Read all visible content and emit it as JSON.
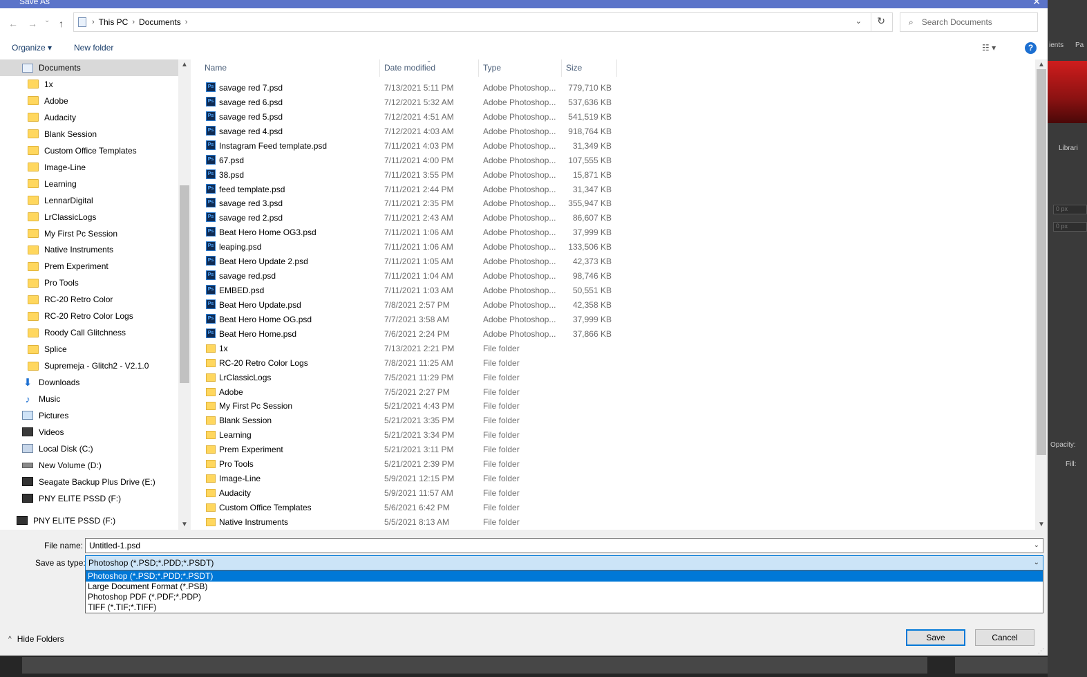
{
  "window": {
    "title": "Save As",
    "close_glyph": "✕"
  },
  "address": {
    "back_glyph": "←",
    "forward_glyph": "→",
    "recent_glyph": "⌄",
    "up_glyph": "↑",
    "crumbs": [
      "This PC",
      "Documents"
    ],
    "separator": "›",
    "dropdown_glyph": "⌄",
    "refresh_glyph": "↻",
    "search_placeholder": "Search Documents",
    "search_icon_glyph": "⌕"
  },
  "toolbar": {
    "organize_label": "Organize ▾",
    "new_folder_label": "New folder",
    "view_glyph": "☷ ▾",
    "help_glyph": "?"
  },
  "nav_items": [
    {
      "label": "Documents",
      "icon": "documents-icon",
      "indent": 1,
      "selected": true
    },
    {
      "label": "1x",
      "icon": "folder-icon",
      "indent": 2
    },
    {
      "label": "Adobe",
      "icon": "folder-icon",
      "indent": 2
    },
    {
      "label": "Audacity",
      "icon": "folder-icon",
      "indent": 2
    },
    {
      "label": "Blank Session",
      "icon": "folder-icon",
      "indent": 2
    },
    {
      "label": "Custom Office Templates",
      "icon": "folder-icon",
      "indent": 2
    },
    {
      "label": "Image-Line",
      "icon": "folder-icon",
      "indent": 2
    },
    {
      "label": "Learning",
      "icon": "folder-icon",
      "indent": 2
    },
    {
      "label": "LennarDigital",
      "icon": "folder-icon",
      "indent": 2
    },
    {
      "label": "LrClassicLogs",
      "icon": "folder-icon",
      "indent": 2
    },
    {
      "label": "My First Pc Session",
      "icon": "folder-icon",
      "indent": 2
    },
    {
      "label": "Native Instruments",
      "icon": "folder-icon",
      "indent": 2
    },
    {
      "label": "Prem Experiment",
      "icon": "folder-icon",
      "indent": 2
    },
    {
      "label": "Pro Tools",
      "icon": "folder-icon",
      "indent": 2
    },
    {
      "label": "RC-20 Retro Color",
      "icon": "folder-icon",
      "indent": 2
    },
    {
      "label": "RC-20 Retro Color Logs",
      "icon": "folder-icon",
      "indent": 2
    },
    {
      "label": "Roody Call Glitchness",
      "icon": "folder-icon",
      "indent": 2
    },
    {
      "label": "Splice",
      "icon": "folder-icon",
      "indent": 2
    },
    {
      "label": "Supremeja - Glitch2 - V2.1.0",
      "icon": "folder-icon",
      "indent": 2
    },
    {
      "label": "Downloads",
      "icon": "downloads-icon",
      "indent": 1
    },
    {
      "label": "Music",
      "icon": "music-icon",
      "indent": 1
    },
    {
      "label": "Pictures",
      "icon": "pictures-icon",
      "indent": 1
    },
    {
      "label": "Videos",
      "icon": "videos-icon",
      "indent": 1
    },
    {
      "label": "Local Disk (C:)",
      "icon": "local-disk-icon",
      "indent": 1
    },
    {
      "label": "New Volume (D:)",
      "icon": "drive-icon",
      "indent": 1
    },
    {
      "label": "Seagate Backup Plus Drive (E:)",
      "icon": "usb-drive-icon",
      "indent": 1
    },
    {
      "label": "PNY ELITE PSSD (F:)",
      "icon": "usb-drive-icon",
      "indent": 1
    },
    {
      "label": "PNY ELITE PSSD (F:)",
      "icon": "usb-drive-icon",
      "indent": 0
    }
  ],
  "columns": {
    "name": "Name",
    "date": "Date modified",
    "type": "Type",
    "size": "Size",
    "sort_glyph": "⌄"
  },
  "files": [
    {
      "name": "savage red 7.psd",
      "date": "7/13/2021 5:11 PM",
      "type": "Adobe Photoshop...",
      "size": "779,710 KB",
      "kind": "psd"
    },
    {
      "name": "savage red 6.psd",
      "date": "7/12/2021 5:32 AM",
      "type": "Adobe Photoshop...",
      "size": "537,636 KB",
      "kind": "psd"
    },
    {
      "name": "savage red 5.psd",
      "date": "7/12/2021 4:51 AM",
      "type": "Adobe Photoshop...",
      "size": "541,519 KB",
      "kind": "psd"
    },
    {
      "name": "savage red 4.psd",
      "date": "7/12/2021 4:03 AM",
      "type": "Adobe Photoshop...",
      "size": "918,764 KB",
      "kind": "psd"
    },
    {
      "name": "Instagram Feed template.psd",
      "date": "7/11/2021 4:03 PM",
      "type": "Adobe Photoshop...",
      "size": "31,349 KB",
      "kind": "psd"
    },
    {
      "name": "67.psd",
      "date": "7/11/2021 4:00 PM",
      "type": "Adobe Photoshop...",
      "size": "107,555 KB",
      "kind": "psd"
    },
    {
      "name": "38.psd",
      "date": "7/11/2021 3:55 PM",
      "type": "Adobe Photoshop...",
      "size": "15,871 KB",
      "kind": "psd"
    },
    {
      "name": "feed template.psd",
      "date": "7/11/2021 2:44 PM",
      "type": "Adobe Photoshop...",
      "size": "31,347 KB",
      "kind": "psd"
    },
    {
      "name": "savage red 3.psd",
      "date": "7/11/2021 2:35 PM",
      "type": "Adobe Photoshop...",
      "size": "355,947 KB",
      "kind": "psd"
    },
    {
      "name": "savage red 2.psd",
      "date": "7/11/2021 2:43 AM",
      "type": "Adobe Photoshop...",
      "size": "86,607 KB",
      "kind": "psd"
    },
    {
      "name": "Beat Hero Home OG3.psd",
      "date": "7/11/2021 1:06 AM",
      "type": "Adobe Photoshop...",
      "size": "37,999 KB",
      "kind": "psd"
    },
    {
      "name": "leaping.psd",
      "date": "7/11/2021 1:06 AM",
      "type": "Adobe Photoshop...",
      "size": "133,506 KB",
      "kind": "psd"
    },
    {
      "name": "Beat Hero Update 2.psd",
      "date": "7/11/2021 1:05 AM",
      "type": "Adobe Photoshop...",
      "size": "42,373 KB",
      "kind": "psd"
    },
    {
      "name": "savage red.psd",
      "date": "7/11/2021 1:04 AM",
      "type": "Adobe Photoshop...",
      "size": "98,746 KB",
      "kind": "psd"
    },
    {
      "name": "EMBED.psd",
      "date": "7/11/2021 1:03 AM",
      "type": "Adobe Photoshop...",
      "size": "50,551 KB",
      "kind": "psd"
    },
    {
      "name": "Beat Hero Update.psd",
      "date": "7/8/2021 2:57 PM",
      "type": "Adobe Photoshop...",
      "size": "42,358 KB",
      "kind": "psd"
    },
    {
      "name": "Beat Hero Home OG.psd",
      "date": "7/7/2021 3:58 AM",
      "type": "Adobe Photoshop...",
      "size": "37,999 KB",
      "kind": "psd"
    },
    {
      "name": "Beat Hero Home.psd",
      "date": "7/6/2021 2:24 PM",
      "type": "Adobe Photoshop...",
      "size": "37,866 KB",
      "kind": "psd"
    },
    {
      "name": "1x",
      "date": "7/13/2021 2:21 PM",
      "type": "File folder",
      "size": "",
      "kind": "folder"
    },
    {
      "name": "RC-20 Retro Color Logs",
      "date": "7/8/2021 11:25 AM",
      "type": "File folder",
      "size": "",
      "kind": "folder"
    },
    {
      "name": "LrClassicLogs",
      "date": "7/5/2021 11:29 PM",
      "type": "File folder",
      "size": "",
      "kind": "folder"
    },
    {
      "name": "Adobe",
      "date": "7/5/2021 2:27 PM",
      "type": "File folder",
      "size": "",
      "kind": "folder"
    },
    {
      "name": "My First Pc Session",
      "date": "5/21/2021 4:43 PM",
      "type": "File folder",
      "size": "",
      "kind": "folder"
    },
    {
      "name": "Blank Session",
      "date": "5/21/2021 3:35 PM",
      "type": "File folder",
      "size": "",
      "kind": "folder"
    },
    {
      "name": "Learning",
      "date": "5/21/2021 3:34 PM",
      "type": "File folder",
      "size": "",
      "kind": "folder"
    },
    {
      "name": "Prem Experiment",
      "date": "5/21/2021 3:11 PM",
      "type": "File folder",
      "size": "",
      "kind": "folder"
    },
    {
      "name": "Pro Tools",
      "date": "5/21/2021 2:39 PM",
      "type": "File folder",
      "size": "",
      "kind": "folder"
    },
    {
      "name": "Image-Line",
      "date": "5/9/2021 12:15 PM",
      "type": "File folder",
      "size": "",
      "kind": "folder"
    },
    {
      "name": "Audacity",
      "date": "5/9/2021 11:57 AM",
      "type": "File folder",
      "size": "",
      "kind": "folder"
    },
    {
      "name": "Custom Office Templates",
      "date": "5/6/2021 6:42 PM",
      "type": "File folder",
      "size": "",
      "kind": "folder"
    },
    {
      "name": "Native Instruments",
      "date": "5/5/2021 8:13 AM",
      "type": "File folder",
      "size": "",
      "kind": "folder"
    }
  ],
  "form": {
    "file_name_label": "File name:",
    "file_name_value": "Untitled-1.psd",
    "save_type_label": "Save as type:",
    "save_type_value": "Photoshop (*.PSD;*.PDD;*.PSDT)",
    "dropdown_glyph": "⌄",
    "type_options": [
      "Photoshop (*.PSD;*.PDD;*.PSDT)",
      "Large Document Format (*.PSB)",
      "Photoshop PDF (*.PDF;*.PDP)",
      "TIFF (*.TIF;*.TIFF)"
    ],
    "selected_option_index": 0
  },
  "footer": {
    "hide_folders_label": "Hide Folders",
    "hide_folders_glyph": "^",
    "save_label": "Save",
    "cancel_label": "Cancel"
  },
  "background_app": {
    "tabs": [
      "ients",
      "Pa",
      "Librari"
    ],
    "px_fields": [
      "0 px",
      "0 px"
    ],
    "opacity_label": "Opacity:",
    "fill_label": "Fill:"
  }
}
